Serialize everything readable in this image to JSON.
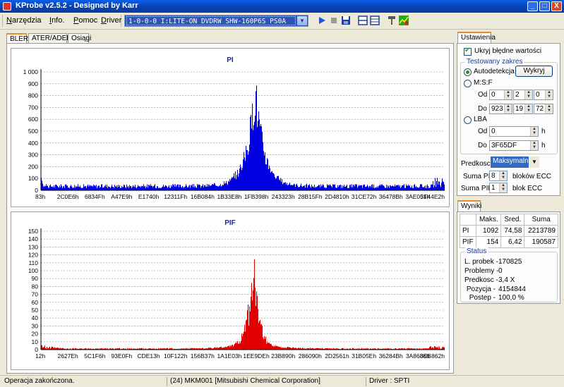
{
  "window": {
    "title": "KProbe v2.5.2 - Designed by Karr",
    "min_label": "_",
    "max_label": "□",
    "close_label": "X"
  },
  "menu": {
    "items": [
      {
        "ul": "N",
        "rest": "arzędzia"
      },
      {
        "ul": "I",
        "rest": "nfo."
      },
      {
        "ul": "P",
        "rest": "omoc"
      },
      {
        "ul": "D",
        "rest": "river"
      }
    ]
  },
  "drive": {
    "selected": "1-0-0-0 I:LITE-ON DVDRW SHW-160P6S PS0A",
    "arrow": "▼"
  },
  "toolbar": {
    "icons": [
      "play-icon",
      "stop-icon",
      "save-icon",
      "view1-icon",
      "view2-icon",
      "tools-icon",
      "graph-icon"
    ]
  },
  "tabs": {
    "bler": "BLER",
    "ater": "ATER/ADER",
    "osiagi": "Osiągi"
  },
  "chart_data": [
    {
      "type": "bar",
      "title": "PI",
      "ylim": [
        0,
        1000
      ],
      "yticks": [
        "0",
        "100",
        "200",
        "300",
        "400",
        "500",
        "600",
        "700",
        "800",
        "900",
        "1 000"
      ],
      "xticks": [
        "83h",
        "2C0E6h",
        "6834Fh",
        "A47E9h",
        "E1740h",
        "12311Fh",
        "16B084h",
        "1B33E8h",
        "1FB398h",
        "243323h",
        "28B15Fh",
        "2D4810h",
        "31CE72h",
        "36478Bh",
        "3AE051h",
        "3F44E2h"
      ],
      "max": 1092,
      "color": "#0000e0",
      "grid": true
    },
    {
      "type": "bar",
      "title": "PIF",
      "ylim": [
        0,
        150
      ],
      "yticks": [
        "0",
        "10",
        "20",
        "30",
        "40",
        "50",
        "60",
        "70",
        "80",
        "90",
        "100",
        "110",
        "120",
        "130",
        "140",
        "150"
      ],
      "xticks": [
        "12h",
        "2627Eh",
        "5C1F6h",
        "93E0Fh",
        "CDE13h",
        "10F122h",
        "156B37h",
        "1A1E03h",
        "1EE9DEh",
        "23B890h",
        "286090h",
        "2D2561h",
        "31B05Eh",
        "36284Bh",
        "3A8686h",
        "3EB862h"
      ],
      "max": 154,
      "color": "#e00000",
      "grid": true
    }
  ],
  "settings": {
    "tab": "Ustawienia",
    "hide_errors": "Ukryj błędne wartości",
    "range_group": "Testowany zakres",
    "auto": "Autodetekcja",
    "detect_btn": "Wykryj",
    "msf": "M:S:F",
    "od": "Od",
    "do": "Do",
    "msf_from": [
      "0",
      "2",
      "0"
    ],
    "msf_to": [
      "923",
      "19",
      "72"
    ],
    "lba": "LBA",
    "lba_from": "0",
    "lba_to": "3F65DF",
    "h": "h",
    "speed_label": "Predkosc",
    "speed_value": "Maksymalna",
    "sum_pi_label": "Suma PI",
    "sum_pi_value": "8",
    "sum_pi_unit": "bloków ECC",
    "sum_pif_label": "Suma PIF",
    "sum_pif_value": "1",
    "sum_pif_unit": "blok ECC"
  },
  "results": {
    "tab": "Wyniki",
    "headers": [
      "",
      "Maks.",
      "Sred.",
      "Suma"
    ],
    "rows": [
      [
        "PI",
        "1092",
        "74,58",
        "2213789"
      ],
      [
        "PIF",
        "154",
        "6,42",
        "190587"
      ]
    ],
    "status_group": "Status",
    "status": [
      {
        "label": "L. probek -",
        "value": "170825"
      },
      {
        "label": "Problemy -",
        "value": "0"
      },
      {
        "label": "Predkosc -",
        "value": "3,4 X"
      },
      {
        "label": "Pozycja -",
        "value": "4154844"
      },
      {
        "label": "Postep -",
        "value": "100,0 %"
      }
    ]
  },
  "statusbar": {
    "left": "Operacja zakończona.",
    "media": "(24) MKM001 [Mitsubishi Chemical Corporation]",
    "driver": "Driver : SPTI"
  }
}
